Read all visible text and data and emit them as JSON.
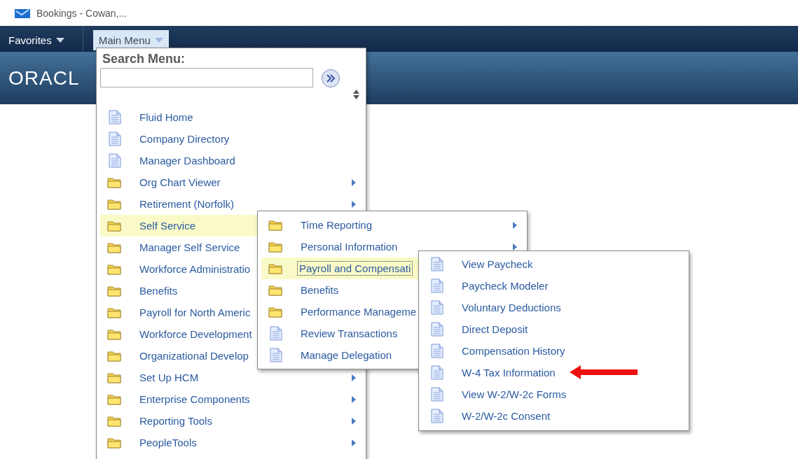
{
  "browser_tab": {
    "title": "Bookings - Cowan,..."
  },
  "nav": {
    "items": [
      {
        "label": "Favorites",
        "selected": false
      },
      {
        "label": "Main Menu",
        "selected": true
      }
    ]
  },
  "banner": {
    "logo": "ORACL"
  },
  "main_menu": {
    "search_label": "Search Menu:",
    "items": [
      {
        "kind": "page",
        "label": "Fluid Home",
        "arrow": false,
        "selected": false
      },
      {
        "kind": "page",
        "label": "Company Directory",
        "arrow": false,
        "selected": false
      },
      {
        "kind": "page",
        "label": "Manager Dashboard",
        "arrow": false,
        "selected": false
      },
      {
        "kind": "folder",
        "label": "Org Chart Viewer",
        "arrow": true,
        "selected": false
      },
      {
        "kind": "folder",
        "label": "Retirement (Norfolk)",
        "arrow": true,
        "selected": false
      },
      {
        "kind": "folder",
        "label": "Self Service",
        "arrow": false,
        "selected": true
      },
      {
        "kind": "folder",
        "label": "Manager Self Service",
        "arrow": false,
        "selected": false
      },
      {
        "kind": "folder",
        "label": "Workforce Administratio",
        "arrow": false,
        "selected": false
      },
      {
        "kind": "folder",
        "label": "Benefits",
        "arrow": false,
        "selected": false
      },
      {
        "kind": "folder",
        "label": "Payroll for North Americ",
        "arrow": false,
        "selected": false
      },
      {
        "kind": "folder",
        "label": "Workforce Development",
        "arrow": false,
        "selected": false
      },
      {
        "kind": "folder",
        "label": "Organizational Develop",
        "arrow": false,
        "selected": false
      },
      {
        "kind": "folder",
        "label": "Set Up HCM",
        "arrow": true,
        "selected": false
      },
      {
        "kind": "folder",
        "label": "Enterprise Components",
        "arrow": true,
        "selected": false
      },
      {
        "kind": "folder",
        "label": "Reporting Tools",
        "arrow": true,
        "selected": false
      },
      {
        "kind": "folder",
        "label": "PeopleTools",
        "arrow": true,
        "selected": false
      }
    ]
  },
  "submenus": [
    {
      "items": [
        {
          "kind": "folder",
          "label": "Time Reporting",
          "arrow": true,
          "selected": false
        },
        {
          "kind": "folder",
          "label": "Personal Information",
          "arrow": true,
          "selected": false
        },
        {
          "kind": "folder",
          "label": "Payroll and Compensati",
          "arrow": false,
          "selected": true
        },
        {
          "kind": "folder",
          "label": "Benefits",
          "arrow": false,
          "selected": false
        },
        {
          "kind": "folder",
          "label": "Performance Manageme",
          "arrow": false,
          "selected": false
        },
        {
          "kind": "page",
          "label": "Review Transactions",
          "arrow": false,
          "selected": false
        },
        {
          "kind": "page",
          "label": "Manage Delegation",
          "arrow": false,
          "selected": false
        }
      ]
    },
    {
      "items": [
        {
          "kind": "page",
          "label": "View Paycheck",
          "arrow": false,
          "selected": false
        },
        {
          "kind": "page",
          "label": "Paycheck Modeler",
          "arrow": false,
          "selected": false
        },
        {
          "kind": "page",
          "label": "Voluntary Deductions",
          "arrow": false,
          "selected": false
        },
        {
          "kind": "page",
          "label": "Direct Deposit",
          "arrow": false,
          "selected": false
        },
        {
          "kind": "page",
          "label": "Compensation History",
          "arrow": false,
          "selected": false
        },
        {
          "kind": "page",
          "label": "W-4 Tax Information",
          "arrow": false,
          "selected": false
        },
        {
          "kind": "page",
          "label": "View W-2/W-2c Forms",
          "arrow": false,
          "selected": false
        },
        {
          "kind": "page",
          "label": "W-2/W-2c Consent",
          "arrow": false,
          "selected": false
        }
      ]
    }
  ]
}
